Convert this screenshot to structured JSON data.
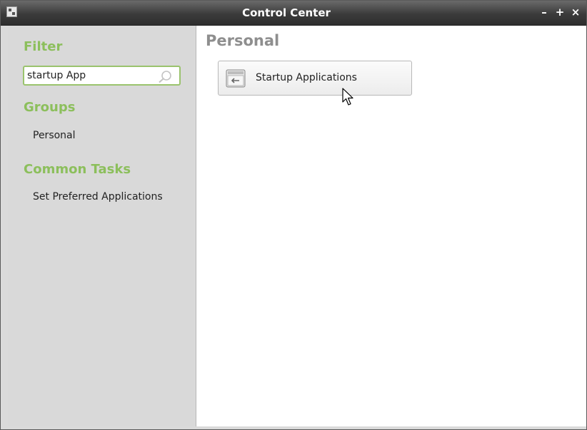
{
  "window": {
    "title": "Control Center",
    "controls": {
      "minimize": "–",
      "maximize": "+",
      "close": "×"
    }
  },
  "sidebar": {
    "filter_heading": "Filter",
    "search": {
      "value": "startup App",
      "placeholder": ""
    },
    "groups_heading": "Groups",
    "groups": [
      {
        "label": "Personal"
      }
    ],
    "tasks_heading": "Common Tasks",
    "tasks": [
      {
        "label": "Set Preferred Applications"
      }
    ]
  },
  "main": {
    "heading": "Personal",
    "items": [
      {
        "label": "Startup Applications",
        "icon": "startup-applications-icon"
      }
    ]
  },
  "colors": {
    "accent_green": "#8cbf5c",
    "titlebar": "#3b3b3b",
    "sidebar_bg": "#d9d9d9",
    "heading_gray": "#8e8e8e"
  }
}
